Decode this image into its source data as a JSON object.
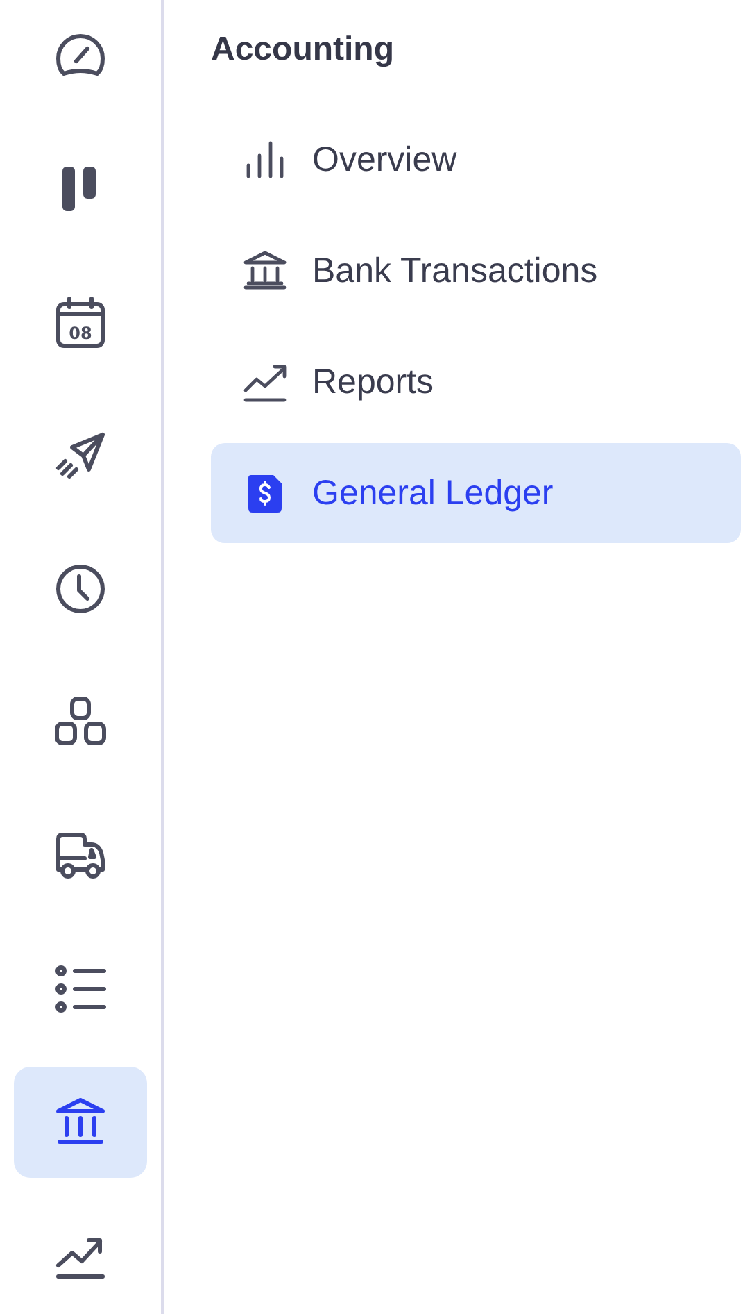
{
  "rail": {
    "items": [
      {
        "kind": "gauge",
        "selected": false
      },
      {
        "kind": "board",
        "selected": false
      },
      {
        "kind": "calendar",
        "text": "08",
        "selected": false
      },
      {
        "kind": "plane",
        "selected": false
      },
      {
        "kind": "clock",
        "selected": false
      },
      {
        "kind": "blocks",
        "selected": false
      },
      {
        "kind": "truck",
        "selected": false
      },
      {
        "kind": "list",
        "selected": false
      },
      {
        "kind": "bank",
        "selected": true
      },
      {
        "kind": "trend",
        "selected": false
      }
    ]
  },
  "panel": {
    "title": "Accounting",
    "items": [
      {
        "label": "Overview",
        "kind": "bars",
        "selected": false
      },
      {
        "label": "Bank Transactions",
        "kind": "bank",
        "selected": false
      },
      {
        "label": "Reports",
        "kind": "trend",
        "selected": false
      },
      {
        "label": "General Ledger",
        "kind": "dollar",
        "selected": true
      }
    ]
  }
}
